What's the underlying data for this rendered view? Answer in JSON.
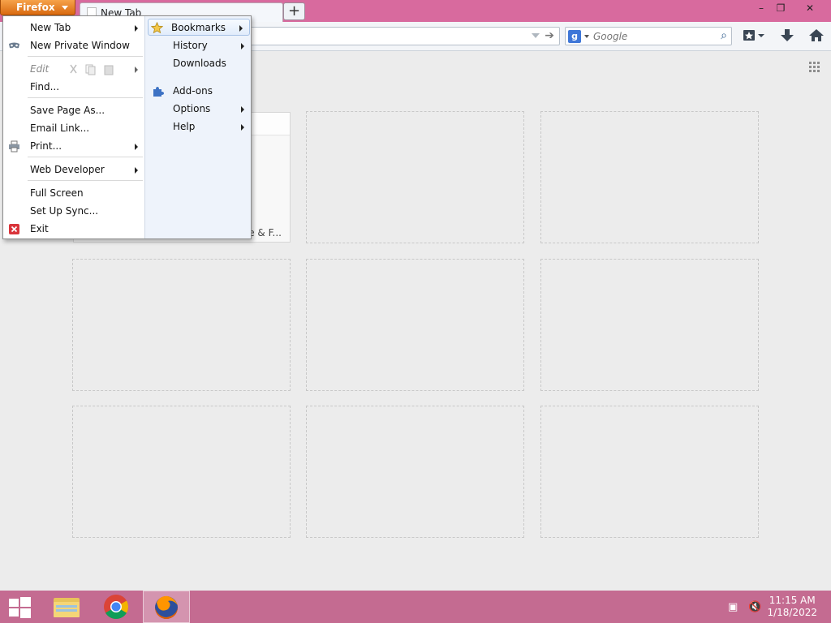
{
  "app": {
    "firefox_button": "Firefox",
    "tab_title": "New Tab",
    "newtab_symbol": "+",
    "window_controls": {
      "minimize": "–",
      "restore": "❐",
      "close": "✕"
    }
  },
  "search": {
    "placeholder": "Google",
    "engine_letter": "g"
  },
  "tiles": {
    "first_tile_title": "e & F..."
  },
  "menu": {
    "left": {
      "new_tab": "New Tab",
      "new_private_window": "New Private Window",
      "edit": "Edit",
      "find": "Find...",
      "save_page_as": "Save Page As...",
      "email_link": "Email Link...",
      "print": "Print...",
      "web_developer": "Web Developer",
      "full_screen": "Full Screen",
      "set_up_sync": "Set Up Sync...",
      "exit": "Exit"
    },
    "right": {
      "bookmarks": "Bookmarks",
      "history": "History",
      "downloads": "Downloads",
      "addons": "Add-ons",
      "options": "Options",
      "help": "Help"
    }
  },
  "taskbar": {
    "time": "11:15 AM",
    "date": "1/18/2022"
  },
  "colors": {
    "titlebar": "#d86a9e",
    "taskbar": "#c46b91",
    "firefox_orange": "#e57c1e"
  }
}
